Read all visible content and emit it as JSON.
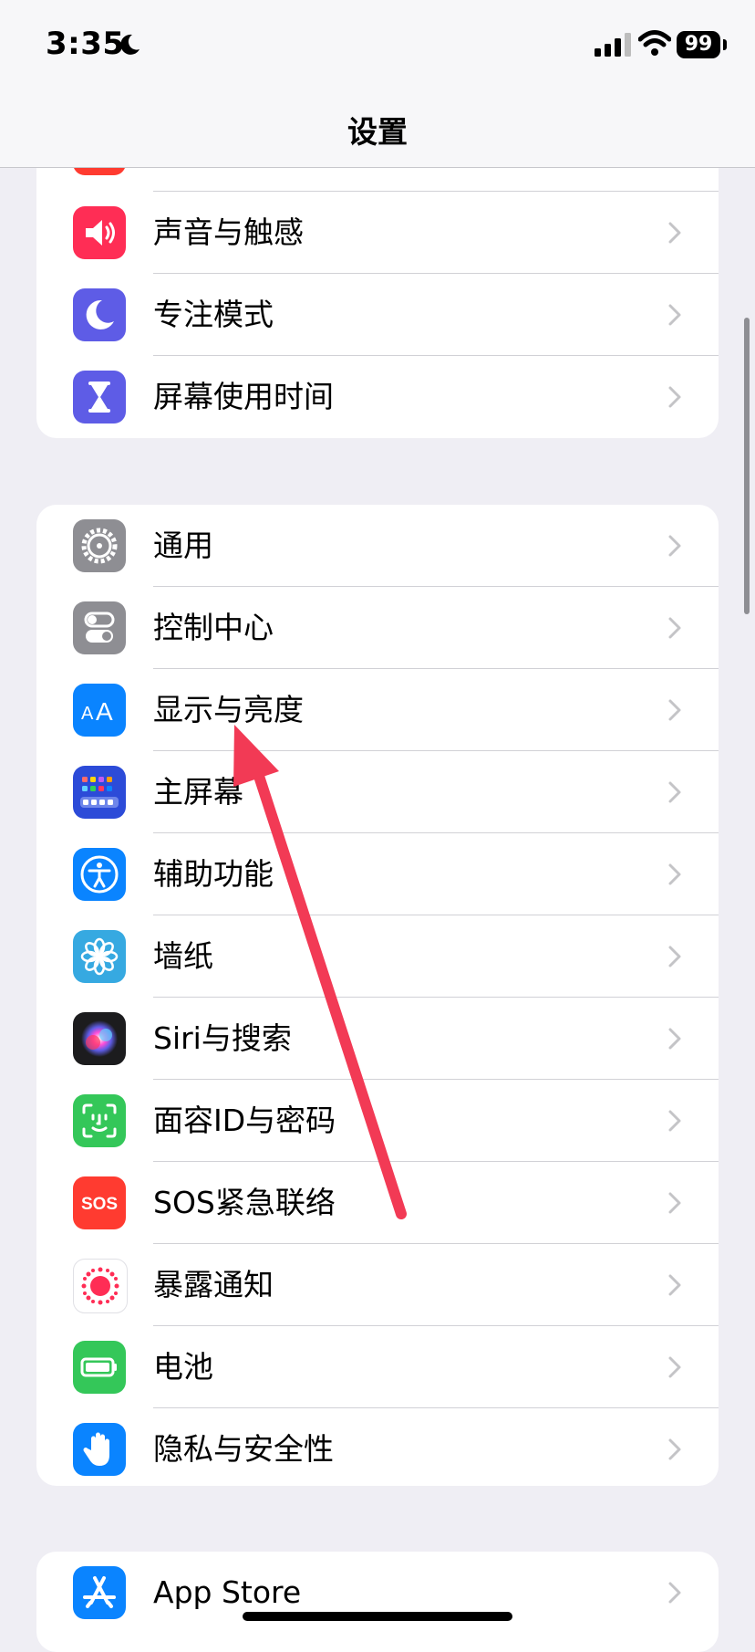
{
  "status_bar": {
    "time": "3:35",
    "battery": "99",
    "icons": [
      "moon-icon",
      "cellular-signal-icon",
      "wifi-icon",
      "battery-icon"
    ]
  },
  "nav": {
    "title": "设置"
  },
  "group1": [
    {
      "label": "声音与触感",
      "icon": "speaker-icon",
      "color": "#ff2d55"
    },
    {
      "label": "专注模式",
      "icon": "moon-icon",
      "color": "#5e5ce6"
    },
    {
      "label": "屏幕使用时间",
      "icon": "hourglass-icon",
      "color": "#5e5ce6"
    }
  ],
  "group2": [
    {
      "label": "通用",
      "icon": "gear-icon",
      "color": "#8e8e93"
    },
    {
      "label": "控制中心",
      "icon": "toggles-icon",
      "color": "#8e8e93"
    },
    {
      "label": "显示与亮度",
      "icon": "text-size-icon",
      "color": "#0a84ff"
    },
    {
      "label": "主屏幕",
      "icon": "home-screen-grid-icon",
      "color": "#2c4bd8"
    },
    {
      "label": "辅助功能",
      "icon": "accessibility-icon",
      "color": "#0a84ff"
    },
    {
      "label": "墙纸",
      "icon": "flower-icon",
      "color": "#36a9e1"
    },
    {
      "label": "Siri与搜索",
      "icon": "siri-icon",
      "color": "#1c1c1e"
    },
    {
      "label": "面容ID与密码",
      "icon": "face-id-icon",
      "color": "#34c759"
    },
    {
      "label": "SOS紧急联络",
      "icon": "sos-icon",
      "color": "#ff3b30"
    },
    {
      "label": "暴露通知",
      "icon": "exposure-icon",
      "color": "#ffffff"
    },
    {
      "label": "电池",
      "icon": "battery-icon",
      "color": "#34c759"
    },
    {
      "label": "隐私与安全性",
      "icon": "hand-icon",
      "color": "#0a84ff"
    }
  ],
  "group3": [
    {
      "label": "App Store",
      "icon": "app-store-icon",
      "color": "#0a84ff"
    }
  ],
  "sos_text": "SOS",
  "colors": {
    "background": "#efeef4",
    "annotation_arrow": "#f23a55",
    "separator": "#d1d1d6"
  }
}
